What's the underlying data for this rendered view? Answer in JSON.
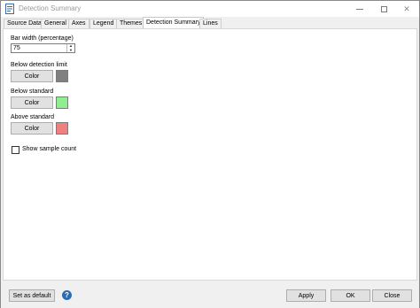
{
  "window": {
    "title": "Detection Summary",
    "controls": {
      "minimize": "—",
      "maximize": "☐",
      "close": "✕"
    }
  },
  "tabs": [
    {
      "label": "Source Data",
      "active": false
    },
    {
      "label": "General",
      "active": false
    },
    {
      "label": "Axes",
      "active": false
    },
    {
      "label": "Legend",
      "active": false
    },
    {
      "label": "Themes",
      "active": false
    },
    {
      "label": "Detection Summary",
      "active": true
    },
    {
      "label": "Lines",
      "active": false
    }
  ],
  "form": {
    "bar_width_label": "Bar width (percentage)",
    "bar_width_value": "75",
    "below_detection_label": "Below detection limit",
    "below_detection_color": "#808080",
    "below_standard_label": "Below standard",
    "below_standard_color": "#90ee90",
    "above_standard_label": "Above standard",
    "above_standard_color": "#f08080",
    "color_button_label": "Color",
    "show_sample_count_label": "Show sample count",
    "show_sample_count_checked": false
  },
  "footer": {
    "set_default_label": "Set as default",
    "help_label": "?",
    "apply_label": "Apply",
    "ok_label": "OK",
    "close_label": "Close"
  }
}
